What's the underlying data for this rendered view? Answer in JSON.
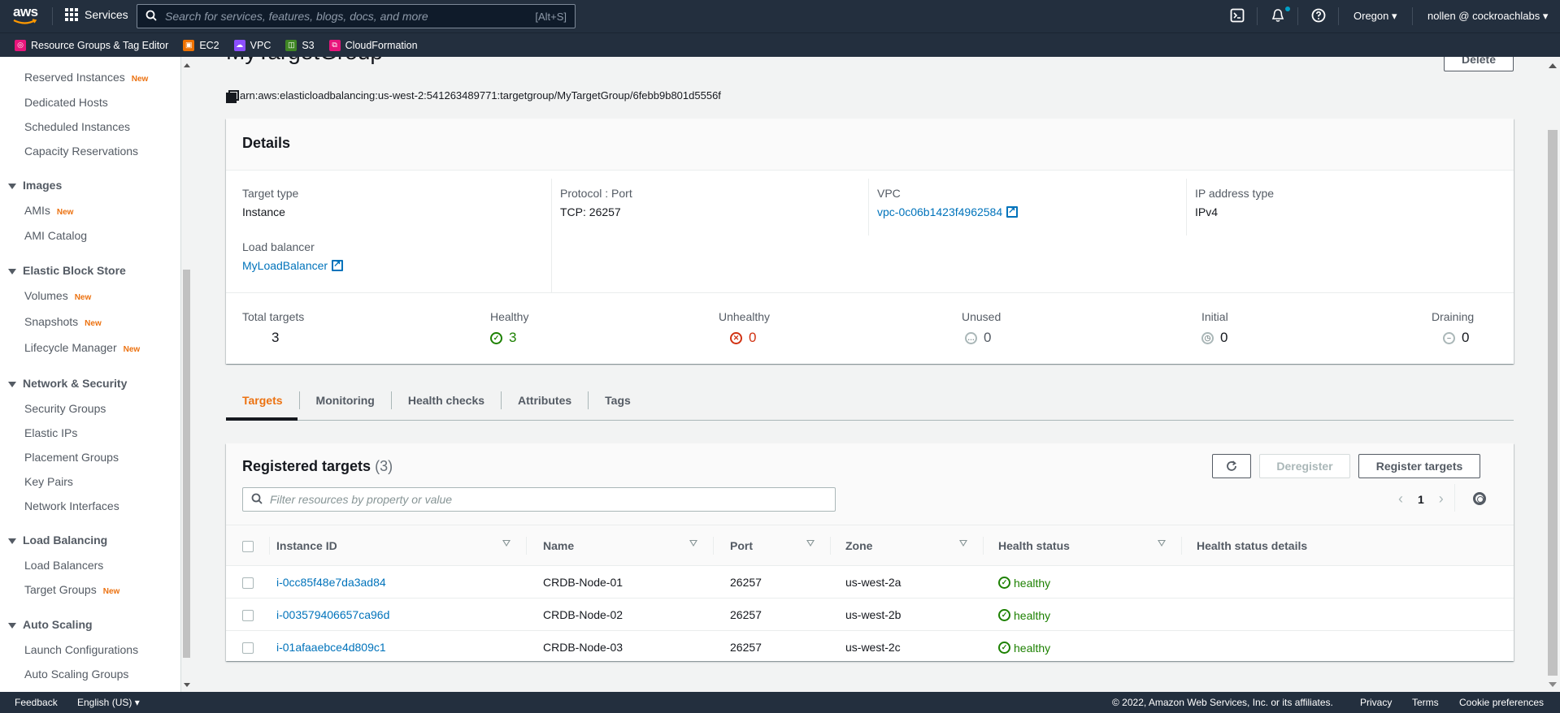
{
  "topnav": {
    "logo": "aws",
    "services_label": "Services",
    "search_placeholder": "Search for services, features, blogs, docs, and more",
    "search_shortcut": "[Alt+S]",
    "region": "Oregon",
    "user": "nollen @ cockroachlabs",
    "icons": [
      "cloudshell-icon",
      "bell-icon",
      "help-icon"
    ]
  },
  "favorites": [
    {
      "label": "Resource Groups & Tag Editor",
      "color": "#e7157b"
    },
    {
      "label": "EC2",
      "color": "#ed7100"
    },
    {
      "label": "VPC",
      "color": "#8c4fff"
    },
    {
      "label": "S3",
      "color": "#3f8624"
    },
    {
      "label": "CloudFormation",
      "color": "#e7157b"
    }
  ],
  "sidebar": {
    "items": [
      {
        "label": "Reserved Instances",
        "new": "New"
      },
      {
        "label": "Dedicated Hosts"
      },
      {
        "label": "Scheduled Instances"
      },
      {
        "label": "Capacity Reservations"
      }
    ],
    "groups": [
      {
        "label": "Images",
        "items": [
          {
            "label": "AMIs",
            "new": "New"
          },
          {
            "label": "AMI Catalog"
          }
        ]
      },
      {
        "label": "Elastic Block Store",
        "items": [
          {
            "label": "Volumes",
            "new": "New"
          },
          {
            "label": "Snapshots",
            "new": "New"
          },
          {
            "label": "Lifecycle Manager",
            "new": "New"
          }
        ]
      },
      {
        "label": "Network & Security",
        "items": [
          {
            "label": "Security Groups"
          },
          {
            "label": "Elastic IPs"
          },
          {
            "label": "Placement Groups"
          },
          {
            "label": "Key Pairs"
          },
          {
            "label": "Network Interfaces"
          }
        ]
      },
      {
        "label": "Load Balancing",
        "items": [
          {
            "label": "Load Balancers"
          },
          {
            "label": "Target Groups",
            "new": "New"
          }
        ]
      },
      {
        "label": "Auto Scaling",
        "items": [
          {
            "label": "Launch Configurations"
          },
          {
            "label": "Auto Scaling Groups"
          }
        ]
      }
    ]
  },
  "page": {
    "title": "MyTargetGroup",
    "delete_label": "Delete",
    "arn": "arn:aws:elasticloadbalancing:us-west-2:541263489771:targetgroup/MyTargetGroup/6febb9b801d5556f"
  },
  "details": {
    "title": "Details",
    "target_type_label": "Target type",
    "target_type": "Instance",
    "protocol_port_label": "Protocol : Port",
    "protocol_port": "TCP: 26257",
    "vpc_label": "VPC",
    "vpc": "vpc-0c06b1423f4962584",
    "ip_type_label": "IP address type",
    "ip_type": "IPv4",
    "lb_label": "Load balancer",
    "lb": "MyLoadBalancer",
    "stats": {
      "total_label": "Total targets",
      "total": "3",
      "healthy_label": "Healthy",
      "healthy": "3",
      "unhealthy_label": "Unhealthy",
      "unhealthy": "0",
      "unused_label": "Unused",
      "unused": "0",
      "initial_label": "Initial",
      "initial": "0",
      "draining_label": "Draining",
      "draining": "0"
    }
  },
  "tabs": [
    "Targets",
    "Monitoring",
    "Health checks",
    "Attributes",
    "Tags"
  ],
  "active_tab": "Targets",
  "registered": {
    "title": "Registered targets",
    "count": "(3)",
    "deregister_label": "Deregister",
    "register_label": "Register targets",
    "filter_placeholder": "Filter resources by property or value",
    "page": "1",
    "columns": [
      "Instance ID",
      "Name",
      "Port",
      "Zone",
      "Health status",
      "Health status details"
    ],
    "rows": [
      {
        "instance_id": "i-0cc85f48e7da3ad84",
        "name": "CRDB-Node-01",
        "port": "26257",
        "zone": "us-west-2a",
        "health": "healthy",
        "details": ""
      },
      {
        "instance_id": "i-003579406657ca96d",
        "name": "CRDB-Node-02",
        "port": "26257",
        "zone": "us-west-2b",
        "health": "healthy",
        "details": ""
      },
      {
        "instance_id": "i-01afaaebce4d809c1",
        "name": "CRDB-Node-03",
        "port": "26257",
        "zone": "us-west-2c",
        "health": "healthy",
        "details": ""
      }
    ]
  },
  "footer": {
    "feedback": "Feedback",
    "language": "English (US)",
    "copyright": "© 2022, Amazon Web Services, Inc. or its affiliates.",
    "privacy": "Privacy",
    "terms": "Terms",
    "cookies": "Cookie preferences"
  },
  "colors": {
    "nav_bg": "#232f3e",
    "accent": "#ec7211",
    "link": "#0073bb",
    "healthy": "#1d8102",
    "unhealthy": "#d13212"
  }
}
